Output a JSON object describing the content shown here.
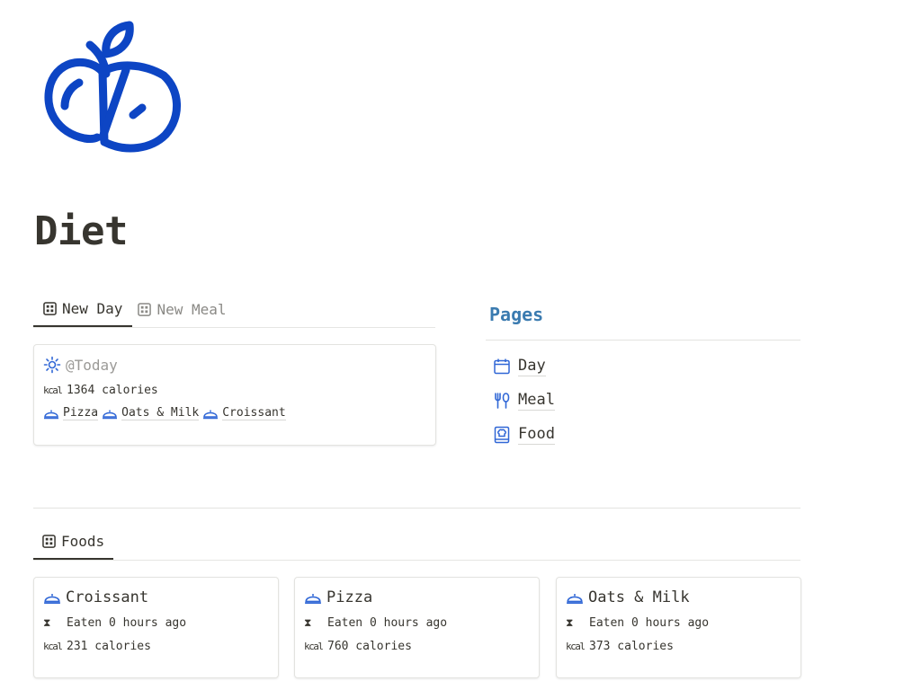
{
  "page": {
    "title": "Diet",
    "icon": "apple-icon"
  },
  "top_tabs": [
    {
      "label": "New Day",
      "icon": "table-icon",
      "active": true
    },
    {
      "label": "New Meal",
      "icon": "table-icon",
      "active": false
    }
  ],
  "today_card": {
    "title": "@Today",
    "title_icon": "sun-icon",
    "calories": "1364 calories",
    "calories_icon": "kcal-icon",
    "foods": [
      "Pizza",
      "Oats & Milk",
      "Croissant"
    ],
    "food_icon": "cloche-icon"
  },
  "pages_section": {
    "heading": "Pages",
    "links": [
      {
        "label": "Day",
        "icon": "calendar-icon"
      },
      {
        "label": "Meal",
        "icon": "utensils-icon"
      },
      {
        "label": "Food",
        "icon": "cookbook-icon"
      }
    ]
  },
  "foods_view": {
    "tab_label": "Foods",
    "tab_icon": "table-icon",
    "cards": [
      {
        "title": "Croissant",
        "eaten": "Eaten 0 hours ago",
        "calories": "231 calories"
      },
      {
        "title": "Pizza",
        "eaten": "Eaten 0 hours ago",
        "calories": "760 calories"
      },
      {
        "title": "Oats & Milk",
        "eaten": "Eaten 0 hours ago",
        "calories": "373 calories"
      }
    ]
  },
  "colors": {
    "accent_blue": "#1447c9",
    "heading_blue": "#3b7bb0",
    "text": "#37352f",
    "muted": "#9b9a97"
  }
}
